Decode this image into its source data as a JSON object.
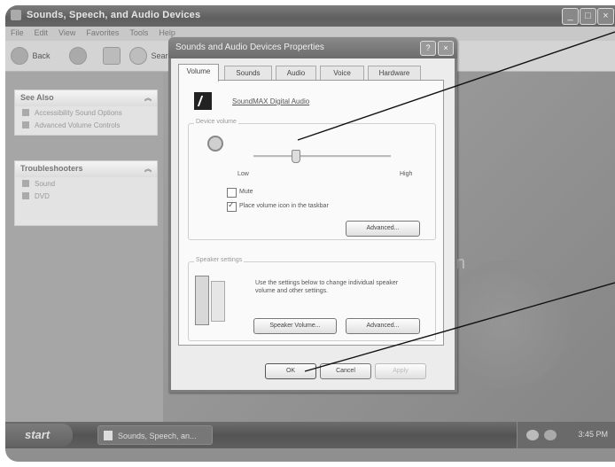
{
  "window": {
    "title": "Sounds, Speech, and Audio Devices",
    "menu": [
      "File",
      "Edit",
      "View",
      "Favorites",
      "Tools",
      "Help"
    ],
    "toolbar": {
      "back": "Back",
      "search": "Search"
    },
    "buttons": {
      "minimize": "_",
      "maximize": "□",
      "close": "×"
    }
  },
  "left_pane": {
    "see_also": {
      "header": "See Also",
      "items": [
        "Accessibility Sound Options",
        "Advanced Volume Controls"
      ]
    },
    "troubleshooters": {
      "header": "Troubleshooters",
      "items": [
        "Sound",
        "DVD"
      ]
    }
  },
  "main": {
    "watermark_text": "n"
  },
  "dialog": {
    "title": "Sounds and Audio Devices Properties",
    "help_btn": "?",
    "close_btn": "×",
    "tabs": [
      "Volume",
      "Sounds",
      "Audio",
      "Voice",
      "Hardware"
    ],
    "active_tab": "Volume",
    "device_name": "SoundMAX Digital Audio",
    "device_volume": {
      "label": "Device volume",
      "low": "Low",
      "high": "High",
      "level": 0.3,
      "mute_label": "Mute",
      "mute_checked": false,
      "taskbar_icon_label": "Place volume icon in the taskbar",
      "taskbar_icon_checked": true,
      "advanced_btn": "Advanced..."
    },
    "speaker_settings": {
      "label": "Speaker settings",
      "description": "Use the settings below to change individual speaker volume and other settings.",
      "speaker_volume_btn": "Speaker Volume...",
      "advanced_btn": "Advanced..."
    },
    "footer": {
      "ok": "OK",
      "cancel": "Cancel",
      "apply": "Apply"
    }
  },
  "taskbar": {
    "start": "start",
    "task": "Sounds, Speech, an...",
    "clock": "3:45 PM"
  }
}
